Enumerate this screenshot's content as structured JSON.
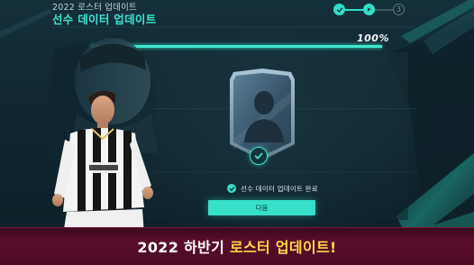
{
  "header": {
    "subtitle": "2022 로스터 업데이트",
    "title": "선수 데이터 업데이트"
  },
  "stepper": {
    "current_step": 2,
    "total_steps": 3,
    "step3_label": "3"
  },
  "progress": {
    "label": "100%",
    "value_percent": 100
  },
  "status": {
    "text": "선수 데이터 업데이트 완료"
  },
  "next_button": {
    "label": "다음"
  },
  "banner": {
    "part1": "2022 하반기 ",
    "part2": "로스터 업데이트!"
  },
  "colors": {
    "accent": "#3ee8cf",
    "banner_bg": "#4a0b24",
    "banner_highlight": "#ffd84a"
  },
  "icons": [
    "check-icon",
    "play-icon",
    "player-silhouette-icon",
    "player-card-icon"
  ]
}
